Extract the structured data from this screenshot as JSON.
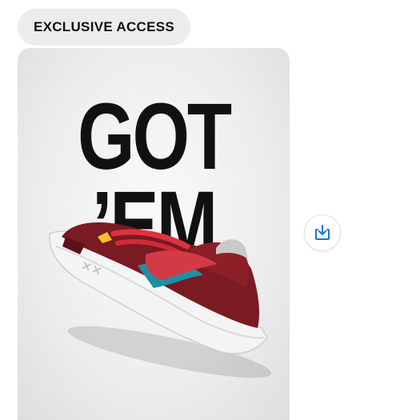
{
  "badge": {
    "label": "EXCLUSIVE ACCESS"
  },
  "card": {
    "headline_line1": "GOT",
    "headline_line2": "’EM",
    "image_subject": "sneaker"
  },
  "actions": {
    "save_icon": "download-icon",
    "accent_color": "#1a73e8"
  }
}
